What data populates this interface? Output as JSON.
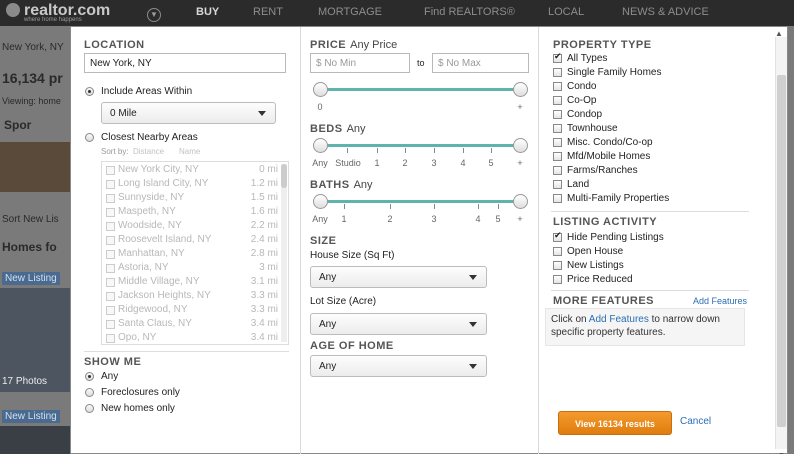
{
  "background": {
    "logo": "realtor.com",
    "tagline": "where home happens",
    "nav": [
      "BUY",
      "RENT",
      "MORTGAGE",
      "Find REALTORS®",
      "LOCAL",
      "NEWS & ADVICE"
    ],
    "left_texts": [
      "New York, NY",
      "16,134 pr",
      "Viewing: home",
      "Spor",
      "Sort  New Lis",
      "Homes fo",
      "New Listing",
      "17 Photos",
      "New Listing"
    ]
  },
  "location": {
    "heading": "LOCATION",
    "value": "New York, NY",
    "include_areas_label": "Include Areas Within",
    "within_value": "0 Mile",
    "closest_label": "Closest Nearby Areas",
    "sort_by": "Sort by:",
    "sort_distance": "Distance",
    "sort_name": "Name",
    "nearby": [
      {
        "name": "New York City, NY",
        "dist": "0 mi"
      },
      {
        "name": "Long Island City, NY",
        "dist": "1.2 mi"
      },
      {
        "name": "Sunnyside, NY",
        "dist": "1.5 mi"
      },
      {
        "name": "Maspeth, NY",
        "dist": "1.6 mi"
      },
      {
        "name": "Woodside, NY",
        "dist": "2.2 mi"
      },
      {
        "name": "Roosevelt Island, NY",
        "dist": "2.4 mi"
      },
      {
        "name": "Manhattan, NY",
        "dist": "2.8 mi"
      },
      {
        "name": "Astoria, NY",
        "dist": "3 mi"
      },
      {
        "name": "Middle Village, NY",
        "dist": "3.1 mi"
      },
      {
        "name": "Jackson Heights, NY",
        "dist": "3.3 mi"
      },
      {
        "name": "Ridgewood, NY",
        "dist": "3.3 mi"
      },
      {
        "name": "Santa Claus, NY",
        "dist": "3.4 mi"
      },
      {
        "name": "Opo, NY",
        "dist": "3.4 mi"
      }
    ]
  },
  "show_me": {
    "heading": "SHOW ME",
    "options": [
      "Any",
      "Foreclosures only",
      "New homes only"
    ],
    "selected": "Any"
  },
  "price": {
    "heading": "PRICE",
    "summary": "Any Price",
    "min_placeholder": "$ No Min",
    "to": "to",
    "max_placeholder": "$ No Max",
    "min_label": "0",
    "max_label": "+"
  },
  "beds": {
    "heading": "BEDS",
    "summary": "Any",
    "ticks": [
      "Any",
      "Studio",
      "1",
      "2",
      "3",
      "4",
      "5",
      "+"
    ]
  },
  "baths": {
    "heading": "BATHS",
    "summary": "Any",
    "ticks": [
      "Any",
      "1",
      "2",
      "3",
      "4",
      "5",
      "+"
    ]
  },
  "size": {
    "heading": "SIZE",
    "house_label": "House Size (Sq Ft)",
    "house_value": "Any",
    "lot_label": "Lot Size (Acre)",
    "lot_value": "Any"
  },
  "age": {
    "heading": "AGE OF HOME",
    "value": "Any"
  },
  "property_type": {
    "heading": "PROPERTY TYPE",
    "items": [
      {
        "label": "All Types",
        "checked": true
      },
      {
        "label": "Single Family Homes",
        "checked": false
      },
      {
        "label": "Condo",
        "checked": false
      },
      {
        "label": "Co-Op",
        "checked": false
      },
      {
        "label": "Condop",
        "checked": false
      },
      {
        "label": "Townhouse",
        "checked": false
      },
      {
        "label": "Misc. Condo/Co-op",
        "checked": false
      },
      {
        "label": "Mfd/Mobile Homes",
        "checked": false
      },
      {
        "label": "Farms/Ranches",
        "checked": false
      },
      {
        "label": "Land",
        "checked": false
      },
      {
        "label": "Multi-Family Properties",
        "checked": false
      }
    ]
  },
  "listing_activity": {
    "heading": "LISTING ACTIVITY",
    "items": [
      {
        "label": "Hide Pending Listings",
        "checked": true
      },
      {
        "label": "Open House",
        "checked": false
      },
      {
        "label": "New Listings",
        "checked": false
      },
      {
        "label": "Price Reduced",
        "checked": false
      }
    ]
  },
  "more_features": {
    "heading": "MORE FEATURES",
    "add_link": "Add Features",
    "text_before": "Click on ",
    "text_link": "Add Features",
    "text_after": " to narrow down specific property features."
  },
  "actions": {
    "view_label": "View 16134 results",
    "cancel_label": "Cancel"
  },
  "colors": {
    "slider": "#5fb3ae",
    "primary_button": "#e98a1c",
    "link": "#2a6fb3"
  }
}
